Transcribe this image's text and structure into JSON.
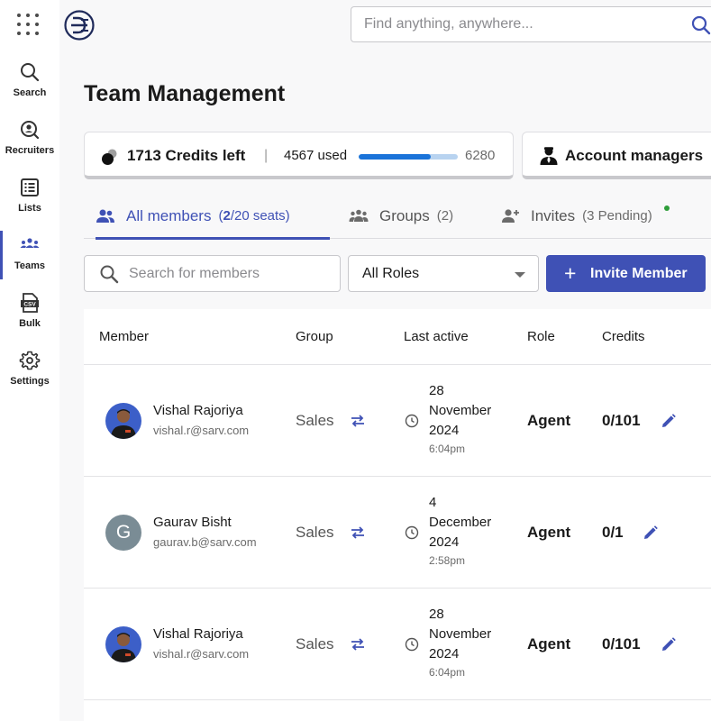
{
  "sidebar": {
    "items": [
      {
        "label": "Search",
        "icon": "search-icon"
      },
      {
        "label": "Recruiters",
        "icon": "recruiter-icon"
      },
      {
        "label": "Lists",
        "icon": "list-icon"
      },
      {
        "label": "Teams",
        "icon": "teams-icon",
        "active": true
      },
      {
        "label": "Bulk",
        "icon": "csv-icon"
      },
      {
        "label": "Settings",
        "icon": "gear-icon"
      }
    ]
  },
  "topbar": {
    "search_placeholder": "Find anything, anywhere..."
  },
  "page": {
    "title": "Team Management"
  },
  "credits": {
    "left_label": "1713 Credits left",
    "separator": "|",
    "used_label": "4567 used",
    "used": 4567,
    "total": 6280,
    "total_label": "6280"
  },
  "managers": {
    "label": "Account managers"
  },
  "tabs": {
    "all": {
      "label": "All members",
      "open": "(",
      "count": "2",
      "rest": "/20 seats)"
    },
    "groups": {
      "label": "Groups",
      "count": "(2)"
    },
    "invites": {
      "label": "Invites",
      "count": "(3 Pending)"
    }
  },
  "filters": {
    "member_search_placeholder": "Search for members",
    "roles_value": "All Roles",
    "invite_plus": "+",
    "invite_label": "Invite Member"
  },
  "table": {
    "headers": {
      "member": "Member",
      "group": "Group",
      "last_active": "Last active",
      "role": "Role",
      "credits": "Credits"
    },
    "rows": [
      {
        "name": "Vishal Rajoriya",
        "email": "vishal.r@sarv.com",
        "group": "Sales",
        "day": "28",
        "month": "November",
        "year": "2024",
        "time": "6:04pm",
        "role": "Agent",
        "credits": "0/101",
        "avatar": "photo"
      },
      {
        "name": "Gaurav Bisht",
        "email": "gaurav.b@sarv.com",
        "group": "Sales",
        "day": "4",
        "month": "December",
        "year": "2024",
        "time": "2:58pm",
        "role": "Agent",
        "credits": "0/1",
        "avatar": "G"
      },
      {
        "name": "Vishal Rajoriya",
        "email": "vishal.r@sarv.com",
        "group": "Sales",
        "day": "28",
        "month": "November",
        "year": "2024",
        "time": "6:04pm",
        "role": "Agent",
        "credits": "0/101",
        "avatar": "photo"
      }
    ]
  },
  "colors": {
    "accent": "#3f51b5",
    "progress": "#1a73d9",
    "progress_track": "#b8d3f0",
    "online_dot": "#2e9d3a"
  }
}
